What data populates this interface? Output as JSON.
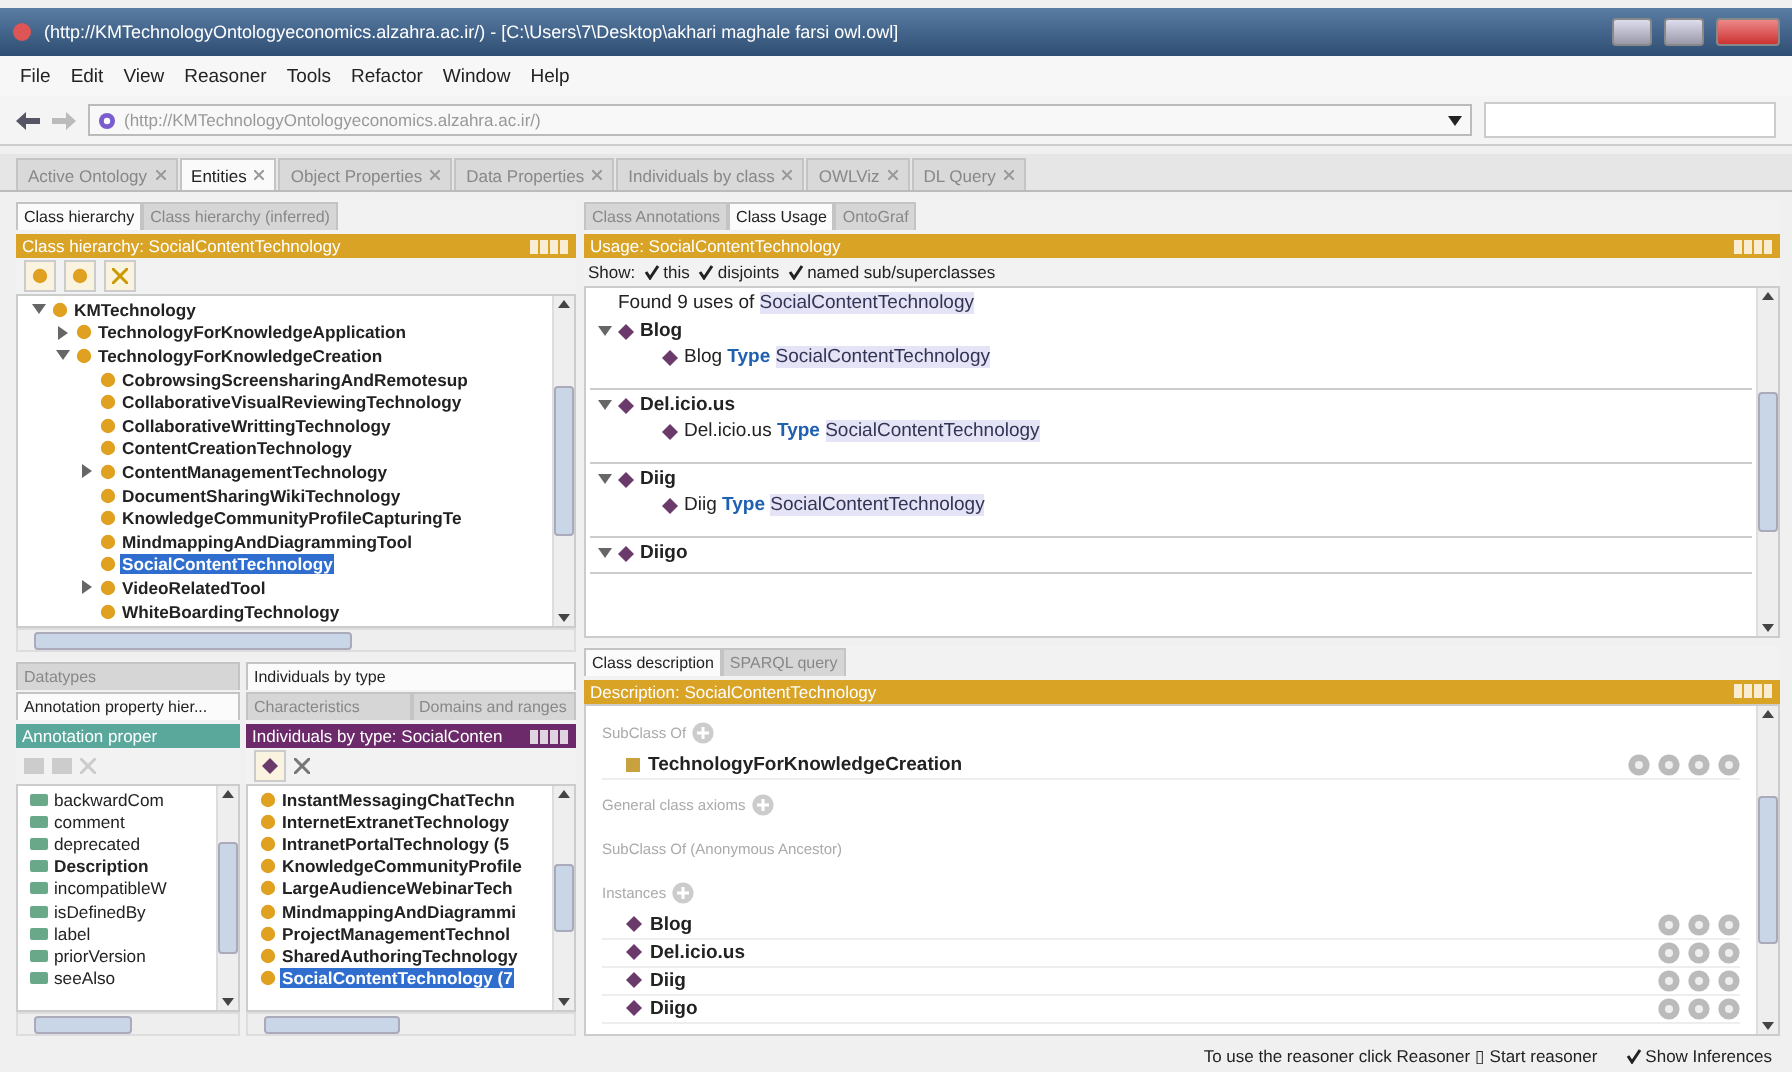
{
  "window": {
    "title": "(http://KMTechnologyOntologyeconomics.alzahra.ac.ir/) - [C:\\Users\\7\\Desktop\\akhari maghale farsi owl.owl]"
  },
  "menu": [
    "File",
    "Edit",
    "View",
    "Reasoner",
    "Tools",
    "Refactor",
    "Window",
    "Help"
  ],
  "address": {
    "url": "(http://KMTechnologyOntologyeconomics.alzahra.ac.ir/)"
  },
  "tabs": [
    {
      "label": "Active Ontology",
      "selected": false
    },
    {
      "label": "Entities",
      "selected": true
    },
    {
      "label": "Object Properties",
      "selected": false
    },
    {
      "label": "Data Properties",
      "selected": false
    },
    {
      "label": "Individuals by class",
      "selected": false
    },
    {
      "label": "OWLViz",
      "selected": false
    },
    {
      "label": "DL Query",
      "selected": false
    }
  ],
  "class_hierarchy": {
    "tabs": [
      {
        "label": "Class hierarchy",
        "selected": true
      },
      {
        "label": "Class hierarchy (inferred)",
        "selected": false
      }
    ],
    "header": "Class hierarchy: SocialContentTechnology",
    "tree": [
      {
        "label": "KMTechnology",
        "expanded": true,
        "selected": false,
        "children": [
          {
            "label": "TechnologyForKnowledgeApplication",
            "expanded": false,
            "selected": false
          },
          {
            "label": "TechnologyForKnowledgeCreation",
            "expanded": true,
            "selected": false,
            "children": [
              {
                "label": "CobrowsingScreensharingAndRemotesup",
                "selected": false
              },
              {
                "label": "CollaborativeVisualReviewingTechnology",
                "selected": false
              },
              {
                "label": "CollaborativeWrittingTechnology",
                "selected": false
              },
              {
                "label": "ContentCreationTechnology",
                "selected": false
              },
              {
                "label": "ContentManagementTechnology",
                "expanded": false,
                "selected": false
              },
              {
                "label": "DocumentSharingWikiTechnology",
                "selected": false
              },
              {
                "label": "KnowledgeCommunityProfileCapturingTe",
                "selected": false
              },
              {
                "label": "MindmappingAndDiagrammingTool",
                "selected": false
              },
              {
                "label": "SocialContentTechnology",
                "selected": true
              },
              {
                "label": "VideoRelatedTool",
                "expanded": false,
                "selected": false
              },
              {
                "label": "WhiteBoardingTechnology",
                "selected": false
              }
            ]
          }
        ]
      }
    ]
  },
  "annotation_properties": {
    "tab_rows": [
      [
        {
          "label": "Datatypes",
          "selected": false
        }
      ],
      [
        {
          "label": "Annotation property hier...",
          "selected": true
        }
      ]
    ],
    "header": "Annotation proper",
    "items": [
      {
        "label": "backwardCom",
        "bold": false
      },
      {
        "label": "comment",
        "bold": false
      },
      {
        "label": "deprecated",
        "bold": false
      },
      {
        "label": "Description",
        "bold": true
      },
      {
        "label": "incompatibleW",
        "bold": false
      },
      {
        "label": "isDefinedBy",
        "bold": false
      },
      {
        "label": "label",
        "bold": false
      },
      {
        "label": "priorVersion",
        "bold": false
      },
      {
        "label": "seeAlso",
        "bold": false
      }
    ]
  },
  "individuals": {
    "tab_rows": [
      [
        {
          "label": "Individuals by type",
          "selected": true
        }
      ],
      [
        {
          "label": "Characteristics",
          "selected": false
        },
        {
          "label": "Domains and ranges",
          "selected": false
        }
      ]
    ],
    "header": "Individuals by type: SocialConten",
    "items": [
      {
        "label": "InstantMessagingChatTechn",
        "selected": false
      },
      {
        "label": "InternetExtranetTechnology",
        "selected": false
      },
      {
        "label": "IntranetPortalTechnology (5",
        "selected": false
      },
      {
        "label": "KnowledgeCommunityProfile",
        "selected": false
      },
      {
        "label": "LargeAudienceWebinarTech",
        "selected": false
      },
      {
        "label": "MindmappingAndDiagrammi",
        "selected": false
      },
      {
        "label": "ProjectManagementTechnol",
        "selected": false
      },
      {
        "label": "SharedAuthoringTechnology",
        "selected": false
      },
      {
        "label": "SocialContentTechnology (7",
        "selected": true
      }
    ]
  },
  "usage": {
    "tabs": [
      {
        "label": "Class Annotations",
        "selected": false
      },
      {
        "label": "Class Usage",
        "selected": true
      },
      {
        "label": "OntoGraf",
        "selected": false
      }
    ],
    "header": "Usage: SocialContentTechnology",
    "show_label": "Show:",
    "filters": [
      {
        "label": "this",
        "checked": true
      },
      {
        "label": "disjoints",
        "checked": true
      },
      {
        "label": "named sub/superclasses",
        "checked": true
      }
    ],
    "found_prefix": "Found 9 uses of",
    "found_entity": "SocialContentTechnology",
    "groups": [
      {
        "name": "Blog",
        "expanded": true,
        "axiom": {
          "subject": "Blog",
          "keyword": "Type",
          "object": "SocialContentTechnology"
        }
      },
      {
        "name": "Del.icio.us",
        "expanded": true,
        "axiom": {
          "subject": "Del.icio.us",
          "keyword": "Type",
          "object": "SocialContentTechnology"
        }
      },
      {
        "name": "Diig",
        "expanded": true,
        "axiom": {
          "subject": "Diig",
          "keyword": "Type",
          "object": "SocialContentTechnology"
        }
      },
      {
        "name": "Diigo",
        "expanded": true
      }
    ]
  },
  "description": {
    "tabs": [
      {
        "label": "Class description",
        "selected": true
      },
      {
        "label": "SPARQL query",
        "selected": false
      }
    ],
    "header": "Description: SocialContentTechnology",
    "sections": [
      {
        "title": "SubClass Of",
        "addable": true,
        "items": [
          {
            "label": "TechnologyForKnowledgeCreation",
            "kind": "class"
          }
        ]
      },
      {
        "title": "General class axioms",
        "addable": true
      },
      {
        "title": "SubClass Of (Anonymous Ancestor)",
        "addable": false
      },
      {
        "title": "Instances",
        "addable": true,
        "items": [
          {
            "label": "Blog",
            "kind": "individual"
          },
          {
            "label": "Del.icio.us",
            "kind": "individual"
          },
          {
            "label": "Diig",
            "kind": "individual"
          },
          {
            "label": "Diigo",
            "kind": "individual"
          }
        ]
      }
    ]
  },
  "status": {
    "message": "To use the reasoner click Reasoner ▯ Start reasoner",
    "show_inferences": {
      "label": "Show Inferences",
      "checked": true
    }
  }
}
